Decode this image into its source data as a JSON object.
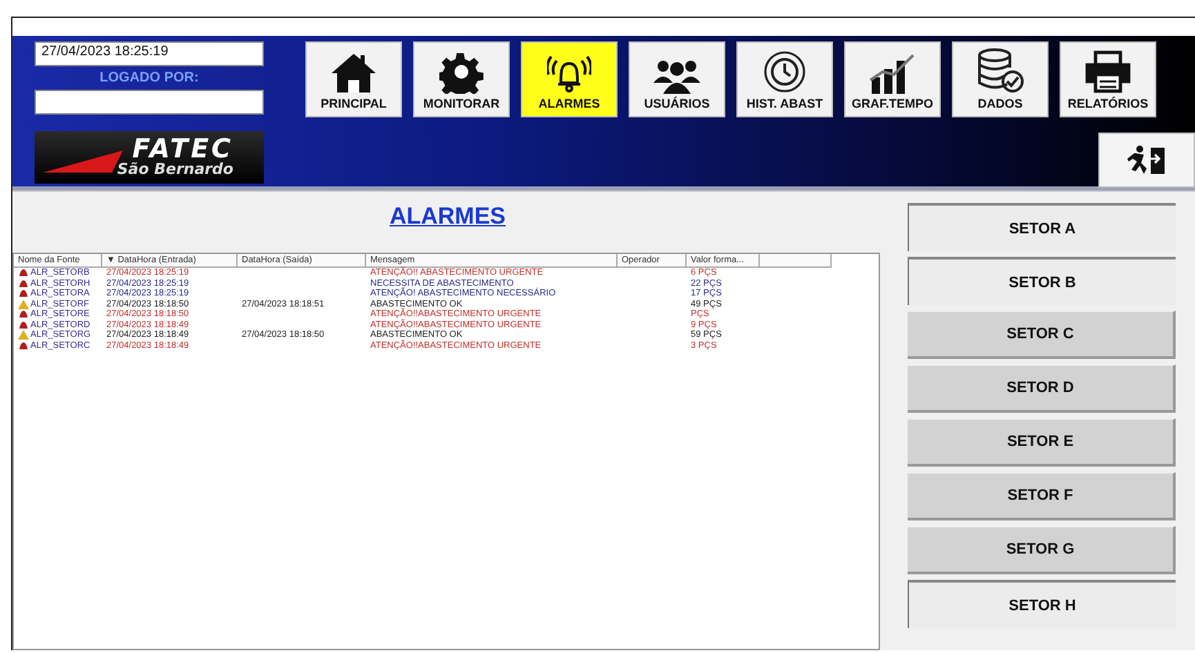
{
  "header": {
    "datetime": "27/04/2023  18:25:19",
    "logged_label": "LOGADO POR:",
    "logo": {
      "title": "FATEC",
      "subtitle": "São Bernardo"
    }
  },
  "nav": [
    {
      "label": "PRINCIPAL",
      "kind": "home",
      "selected": false
    },
    {
      "label": "MONITORAR",
      "kind": "gear",
      "selected": false
    },
    {
      "label": "ALARMES",
      "kind": "bell",
      "selected": true
    },
    {
      "label": "USUÁRIOS",
      "kind": "people",
      "selected": false
    },
    {
      "label": "HIST. ABAST",
      "kind": "clock",
      "selected": false
    },
    {
      "label": "GRAF.TEMPO",
      "kind": "chart",
      "selected": false
    },
    {
      "label": "DADOS",
      "kind": "database",
      "selected": false
    },
    {
      "label": "RELATÓRIOS",
      "kind": "printer",
      "selected": false
    }
  ],
  "page_title": "ALARMES",
  "table": {
    "columns": [
      "Nome da Fonte",
      "▼ DataHora (Entrada)",
      "DataHora (Saída)",
      "Mensagem",
      "Operador",
      "Valor forma..."
    ],
    "rows": [
      {
        "kind": "alarm",
        "color": "#c0302c",
        "source": "ALR_SETORB",
        "in": "27/04/2023 18:25:19",
        "message": "ATENÇÃO!! ABASTECIMENTO URGENTE",
        "value": "6 PÇS"
      },
      {
        "kind": "alarm",
        "color": "#2a2a8c",
        "source": "ALR_SETORH",
        "in": "27/04/2023 18:25:19",
        "message": "NECESSITA DE ABASTECIMENTO",
        "value": "22 PÇS"
      },
      {
        "kind": "alarm",
        "color": "#2a2a8c",
        "source": "ALR_SETORA",
        "in": "27/04/2023 18:25:19",
        "message": "ATENÇÃO! ABASTECIMENTO NECESSÁRIO",
        "value": "17 PÇS"
      },
      {
        "kind": "warning",
        "color": "#222222",
        "source": "ALR_SETORF",
        "in": "27/04/2023 18:18:50",
        "out": "27/04/2023 18:18:51",
        "message": "ABASTECIMENTO OK",
        "value": "49 PÇS"
      },
      {
        "kind": "alarm",
        "color": "#c0302c",
        "source": "ALR_SETORE",
        "in": "27/04/2023 18:18:50",
        "message": "ATENÇÃO!!ABASTECIMENTO URGENTE",
        "value": "PÇS"
      },
      {
        "kind": "alarm",
        "color": "#c0302c",
        "source": "ALR_SETORD",
        "in": "27/04/2023 18:18:49",
        "message": "ATENÇÃO!!ABASTECIMENTO URGENTE",
        "value": "9 PÇS"
      },
      {
        "kind": "warning",
        "color": "#222222",
        "source": "ALR_SETORG",
        "in": "27/04/2023 18:18:49",
        "out": "27/04/2023 18:18:50",
        "message": "ABASTECIMENTO OK",
        "value": "59 PÇS"
      },
      {
        "kind": "alarm",
        "color": "#c0302c",
        "source": "ALR_SETORC",
        "in": "27/04/2023 18:18:49",
        "message": "ATENÇÃO!!ABASTECIMENTO URGENTE",
        "value": "3 PÇS"
      }
    ]
  },
  "sectors": [
    {
      "label": "SETOR A",
      "pressed": true
    },
    {
      "label": "SETOR B",
      "pressed": true
    },
    {
      "label": "SETOR C",
      "pressed": false
    },
    {
      "label": "SETOR D",
      "pressed": false
    },
    {
      "label": "SETOR E",
      "pressed": false
    },
    {
      "label": "SETOR F",
      "pressed": false
    },
    {
      "label": "SETOR G",
      "pressed": false
    },
    {
      "label": "SETOR H",
      "pressed": true
    }
  ]
}
